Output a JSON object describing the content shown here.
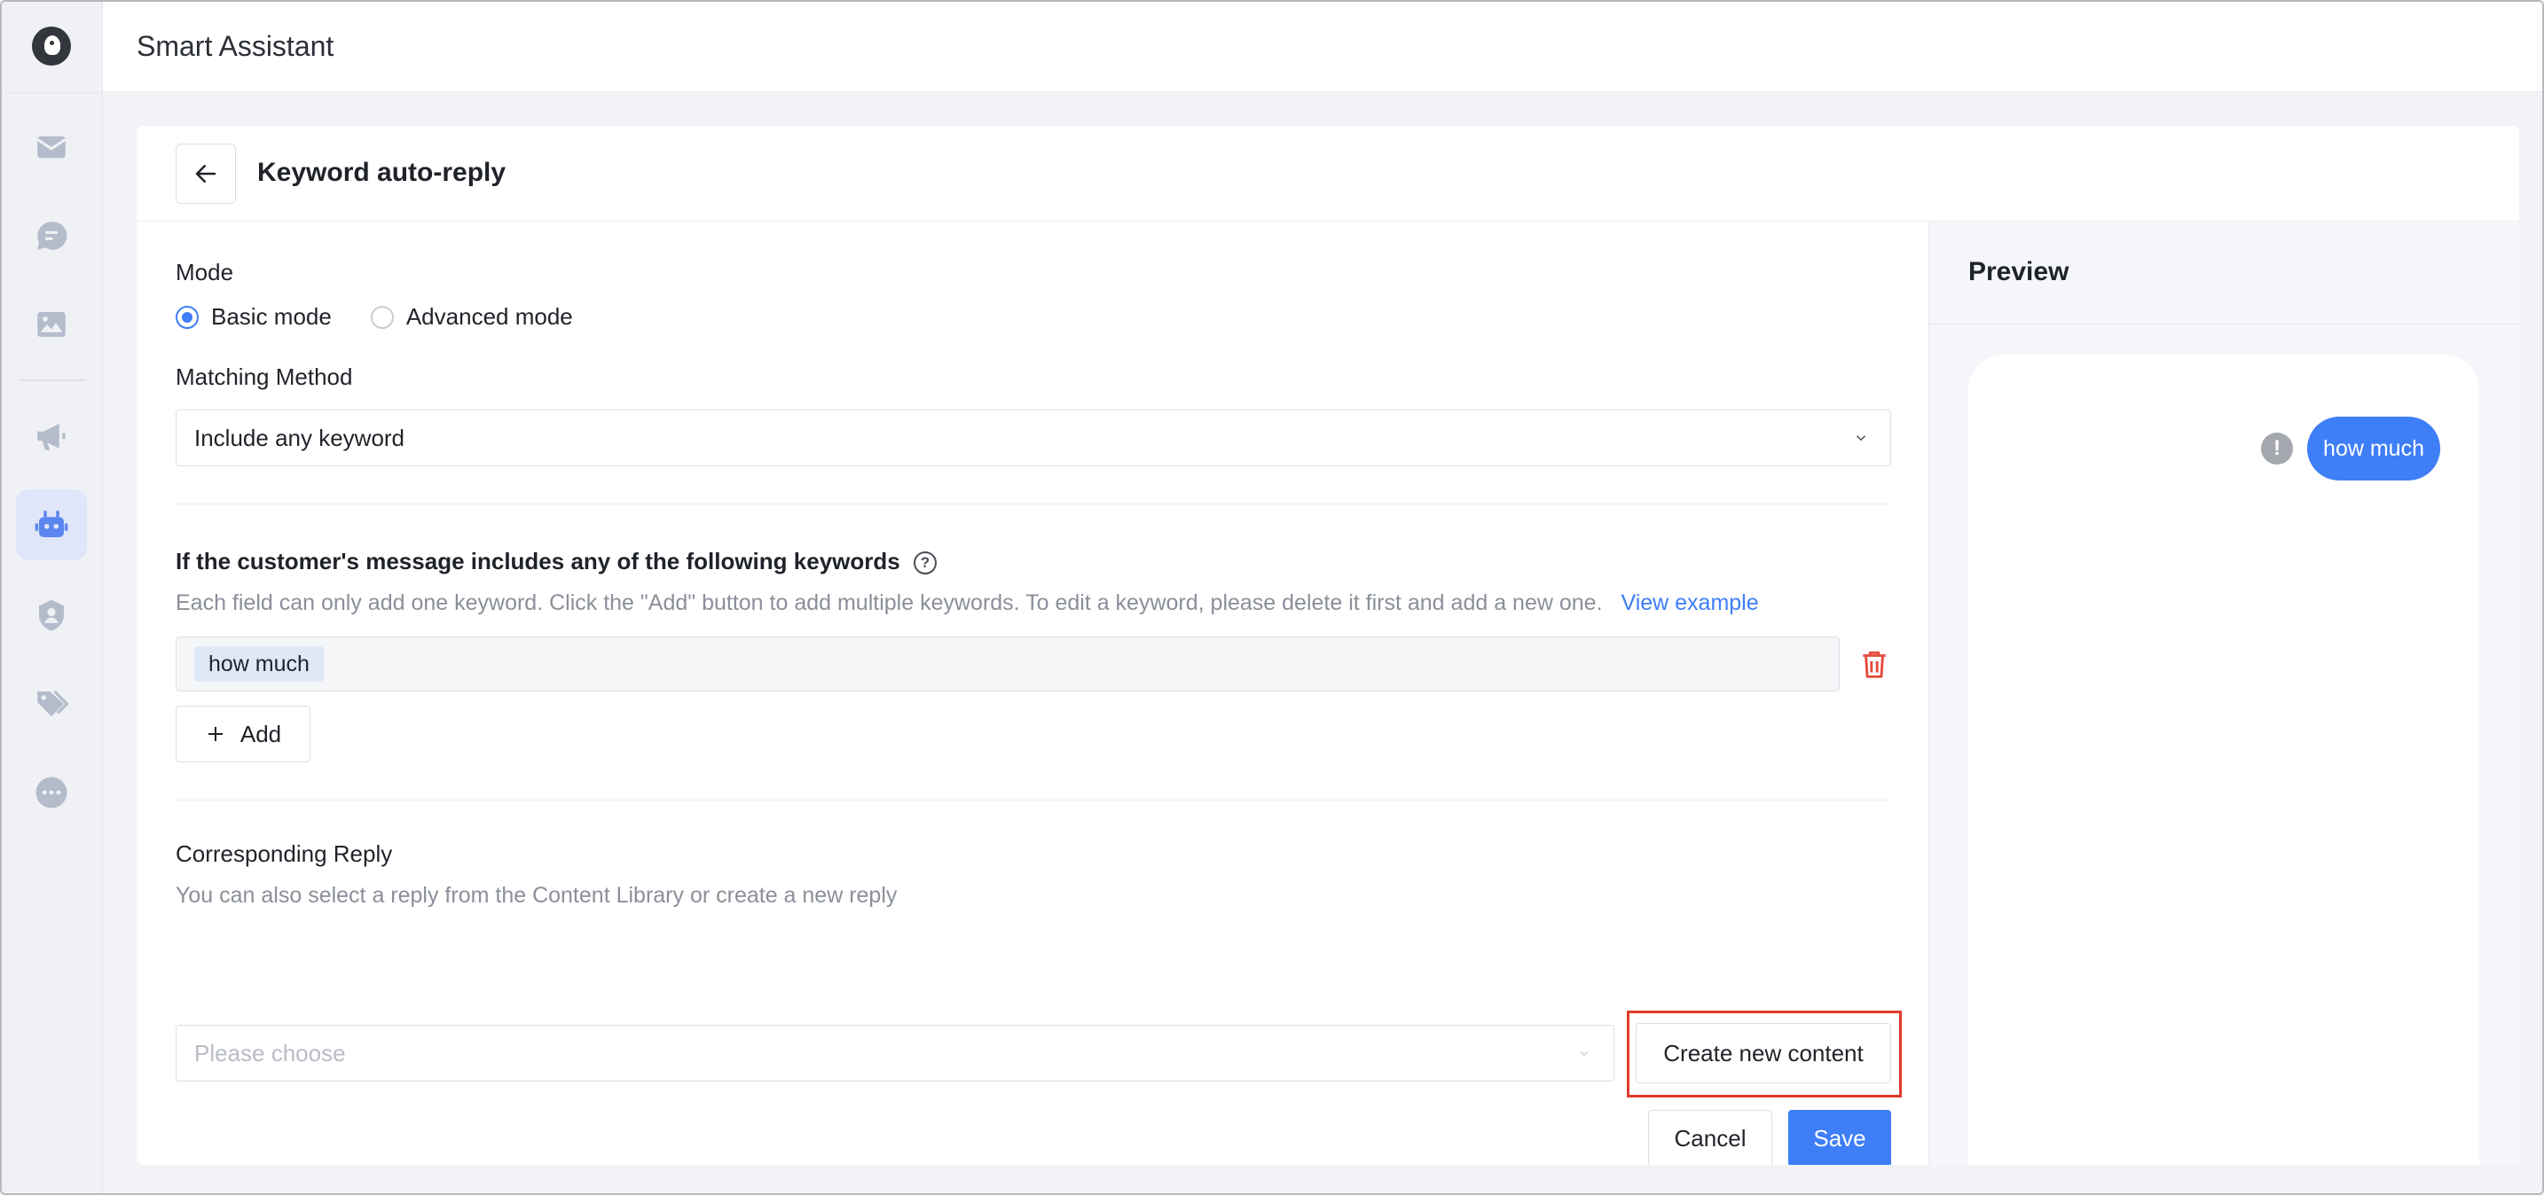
{
  "app": {
    "title": "Smart Assistant"
  },
  "page": {
    "title": "Keyword auto-reply"
  },
  "sidebar": {
    "items": [
      {
        "icon": "inbox-icon"
      },
      {
        "icon": "chat-icon"
      },
      {
        "icon": "image-icon"
      },
      {
        "icon": "megaphone-icon"
      },
      {
        "icon": "robot-icon",
        "active": true
      },
      {
        "icon": "user-shield-icon"
      },
      {
        "icon": "tag-icon"
      },
      {
        "icon": "more-icon"
      }
    ]
  },
  "form": {
    "mode_label": "Mode",
    "mode_options": [
      "Basic mode",
      "Advanced mode"
    ],
    "mode_selected": "Basic mode",
    "matching_label": "Matching Method",
    "matching_value": "Include any keyword",
    "keywords_label": "If the customer's message includes any of the following keywords",
    "keywords_hint": "Each field can only add one keyword. Click the \"Add\" button to add multiple keywords. To edit a keyword, please delete it first and add a new one.",
    "view_example": "View example",
    "keyword_tag": "how much",
    "add_label": "Add",
    "reply_label": "Corresponding Reply",
    "reply_hint": "You can also select a reply from the Content Library or create a new reply",
    "reply_placeholder": "Please choose",
    "create_label": "Create new content",
    "cancel_label": "Cancel",
    "save_label": "Save"
  },
  "preview": {
    "title": "Preview",
    "message": "how much",
    "warning_glyph": "!"
  },
  "colors": {
    "accent": "#3e7ef6",
    "highlight": "#e03b2c",
    "danger": "#e5483b"
  }
}
